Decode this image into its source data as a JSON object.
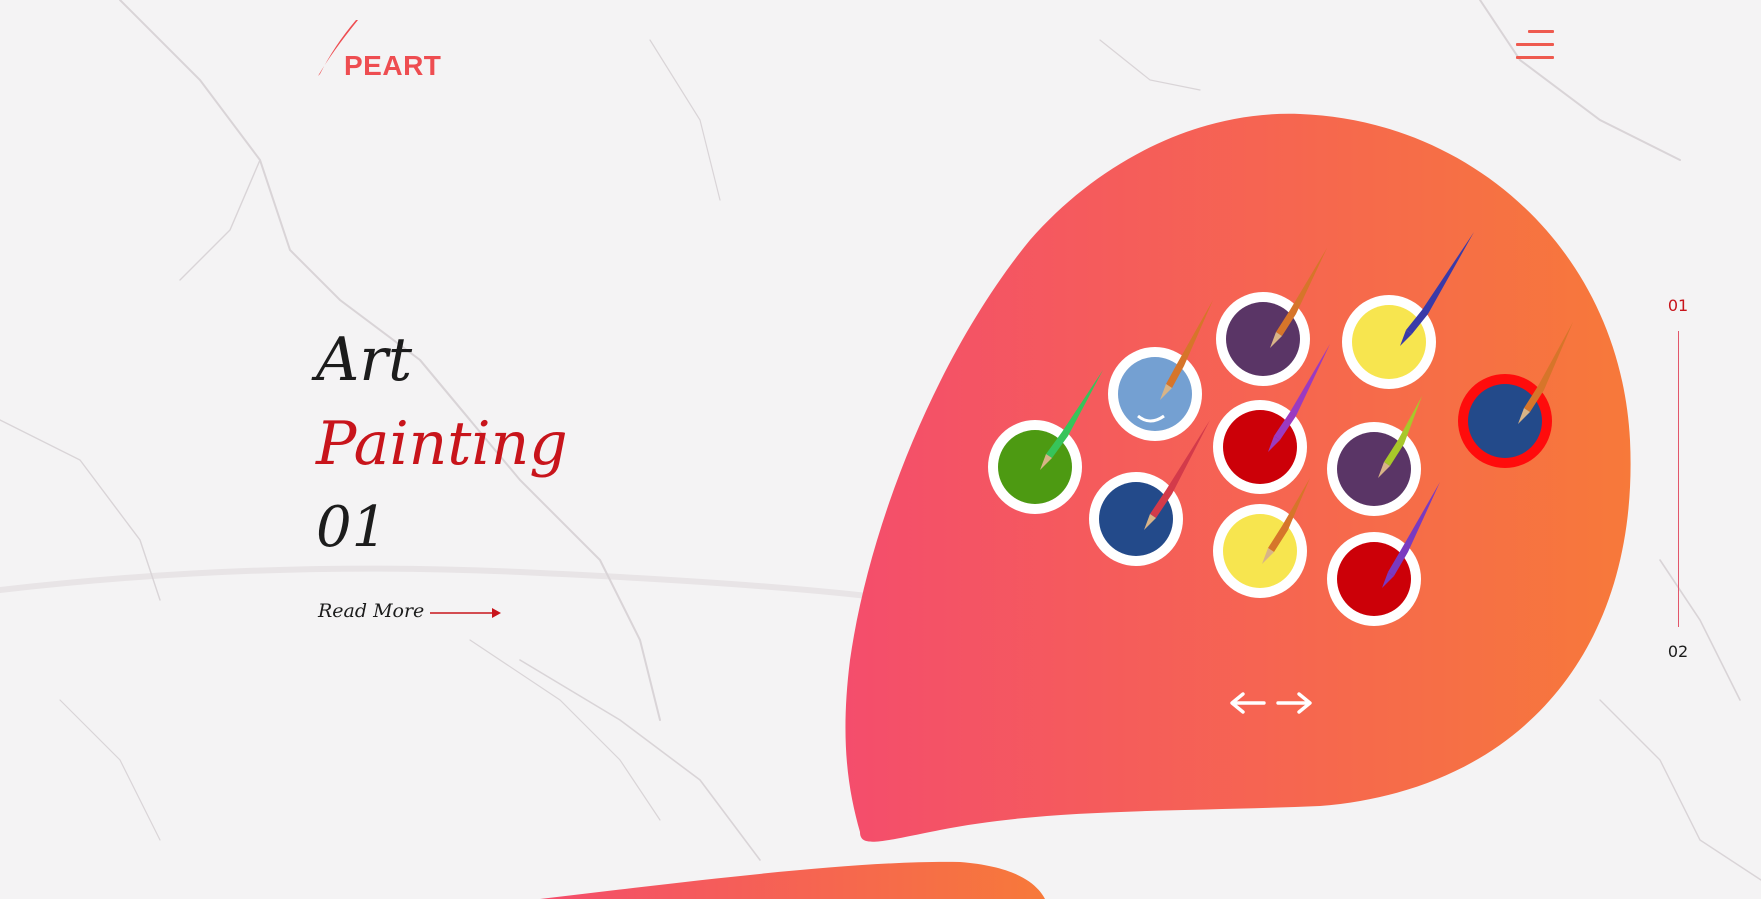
{
  "brand": {
    "name": "PEART",
    "color": "#ee4d51"
  },
  "nav": {
    "menu_icon": "hamburger-menu-icon"
  },
  "hero": {
    "line1": "Art",
    "line2": "Painting",
    "line3": "01",
    "read_more": "Read More"
  },
  "slider": {
    "prev_icon": "arrow-left-icon",
    "next_icon": "arrow-right-icon",
    "pages": [
      "01",
      "02"
    ],
    "current_page": "01"
  },
  "colors": {
    "accent": "#c8141b",
    "blob_gradient_start": "#f44d6c",
    "blob_gradient_end": "#f7793a",
    "background": "#f4f3f4"
  },
  "paints": [
    {
      "name": "green",
      "color": "#4d9a12",
      "brush": "#37c45a"
    },
    {
      "name": "light-blue",
      "color": "#74a0d2",
      "brush": "#d6752a"
    },
    {
      "name": "purple",
      "color": "#5a3566",
      "brush": "#d6752a"
    },
    {
      "name": "yellow",
      "color": "#f7e54f",
      "brush": "#3a3aa8"
    },
    {
      "name": "navy",
      "color": "#234a8a",
      "brush": "#d33a4a"
    },
    {
      "name": "red",
      "color": "#cc0008",
      "brush": "#9b3ac0"
    },
    {
      "name": "purple",
      "color": "#5a3566",
      "brush": "#a8c82a"
    },
    {
      "name": "navy",
      "color": "#234a8a",
      "brush": "#d6752a"
    },
    {
      "name": "yellow",
      "color": "#f7e54f",
      "brush": "#d6752a"
    },
    {
      "name": "red",
      "color": "#cc0008",
      "brush": "#7a3ac0"
    }
  ]
}
